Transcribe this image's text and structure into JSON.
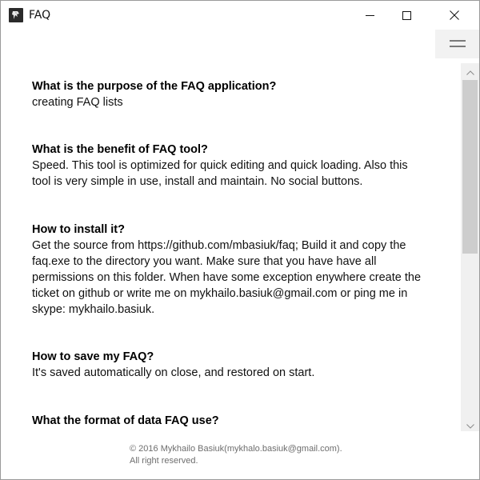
{
  "window": {
    "title": "FAQ",
    "icons": {
      "app": "faq-app-icon",
      "minimize": "minimize-icon",
      "maximize": "maximize-icon",
      "close": "close-icon",
      "menu": "hamburger-menu-icon",
      "scroll_up": "chevron-up-icon",
      "scroll_down": "chevron-down-icon"
    }
  },
  "faq": [
    {
      "question": "What is the purpose of the FAQ application?",
      "answer": "creating FAQ lists"
    },
    {
      "question": "What is the benefit of FAQ tool?",
      "answer_lines": [
        "Speed. This tool is optimized for quick editing and quick loading. Also this",
        "tool is very simple in use, install and maintain. No social buttons."
      ]
    },
    {
      "question": "How to install it?",
      "answer_lines": [
        "Get the source from https://github.com/mbasiuk/faq; Build it and copy the",
        "faq.exe to the directory you want. Make sure that you have have all",
        "permissions on this folder. When have some exception enywhere create the",
        "ticket on github or write me on mykhailo.basiuk@gmail.com or ping me in",
        "skype: mykhailo.basiuk."
      ]
    },
    {
      "question": "How to save my FAQ?",
      "answer": "It's saved automatically on close, and restored on start."
    },
    {
      "question": "What the format of data FAQ use?"
    }
  ],
  "footer": {
    "copyright": "© 2016 Mykhailo Basiuk(mykhalo.basiuk@gmail.com).",
    "rights": "All right reserved."
  },
  "colors": {
    "text": "#111111",
    "footer_text": "#6e6e6e",
    "scrollbar_track": "#f0f0f0",
    "scrollbar_thumb": "#cdcdcd",
    "menu_button_bg": "#f2f2f2"
  }
}
